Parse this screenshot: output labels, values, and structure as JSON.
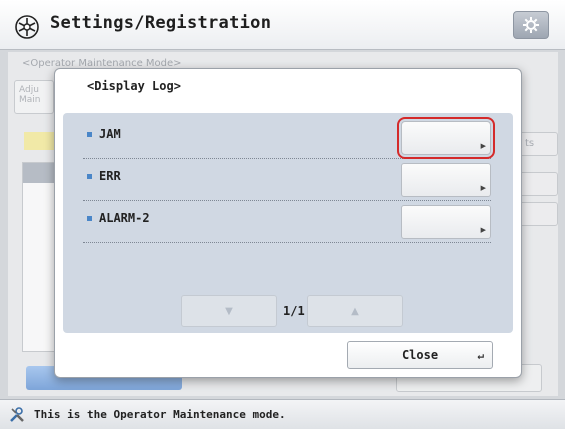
{
  "header": {
    "title": "Settings/Registration",
    "title_icon": "settings-registration-icon",
    "gear_icon": "gear-icon"
  },
  "background": {
    "breadcrumb": "<Operator Maintenance Mode>",
    "left_tab_label": "Adju\nMain",
    "right_button_label": "ts"
  },
  "dialog": {
    "title": "<Display Log>",
    "rows": [
      {
        "label": "JAM",
        "highlighted": true
      },
      {
        "label": "ERR",
        "highlighted": false
      },
      {
        "label": "ALARM-2",
        "highlighted": false
      }
    ],
    "pager": {
      "page_label": "1/1",
      "down_icon": "arrow-down-icon",
      "up_icon": "arrow-up-icon"
    },
    "close_label": "Close"
  },
  "status": {
    "text": "This is the Operator Maintenance mode.",
    "icon": "tools-icon"
  },
  "colors": {
    "accent_blue": "#4a86c8",
    "highlight_red": "#d42a2a",
    "panel_bg": "#d0d8e3"
  }
}
